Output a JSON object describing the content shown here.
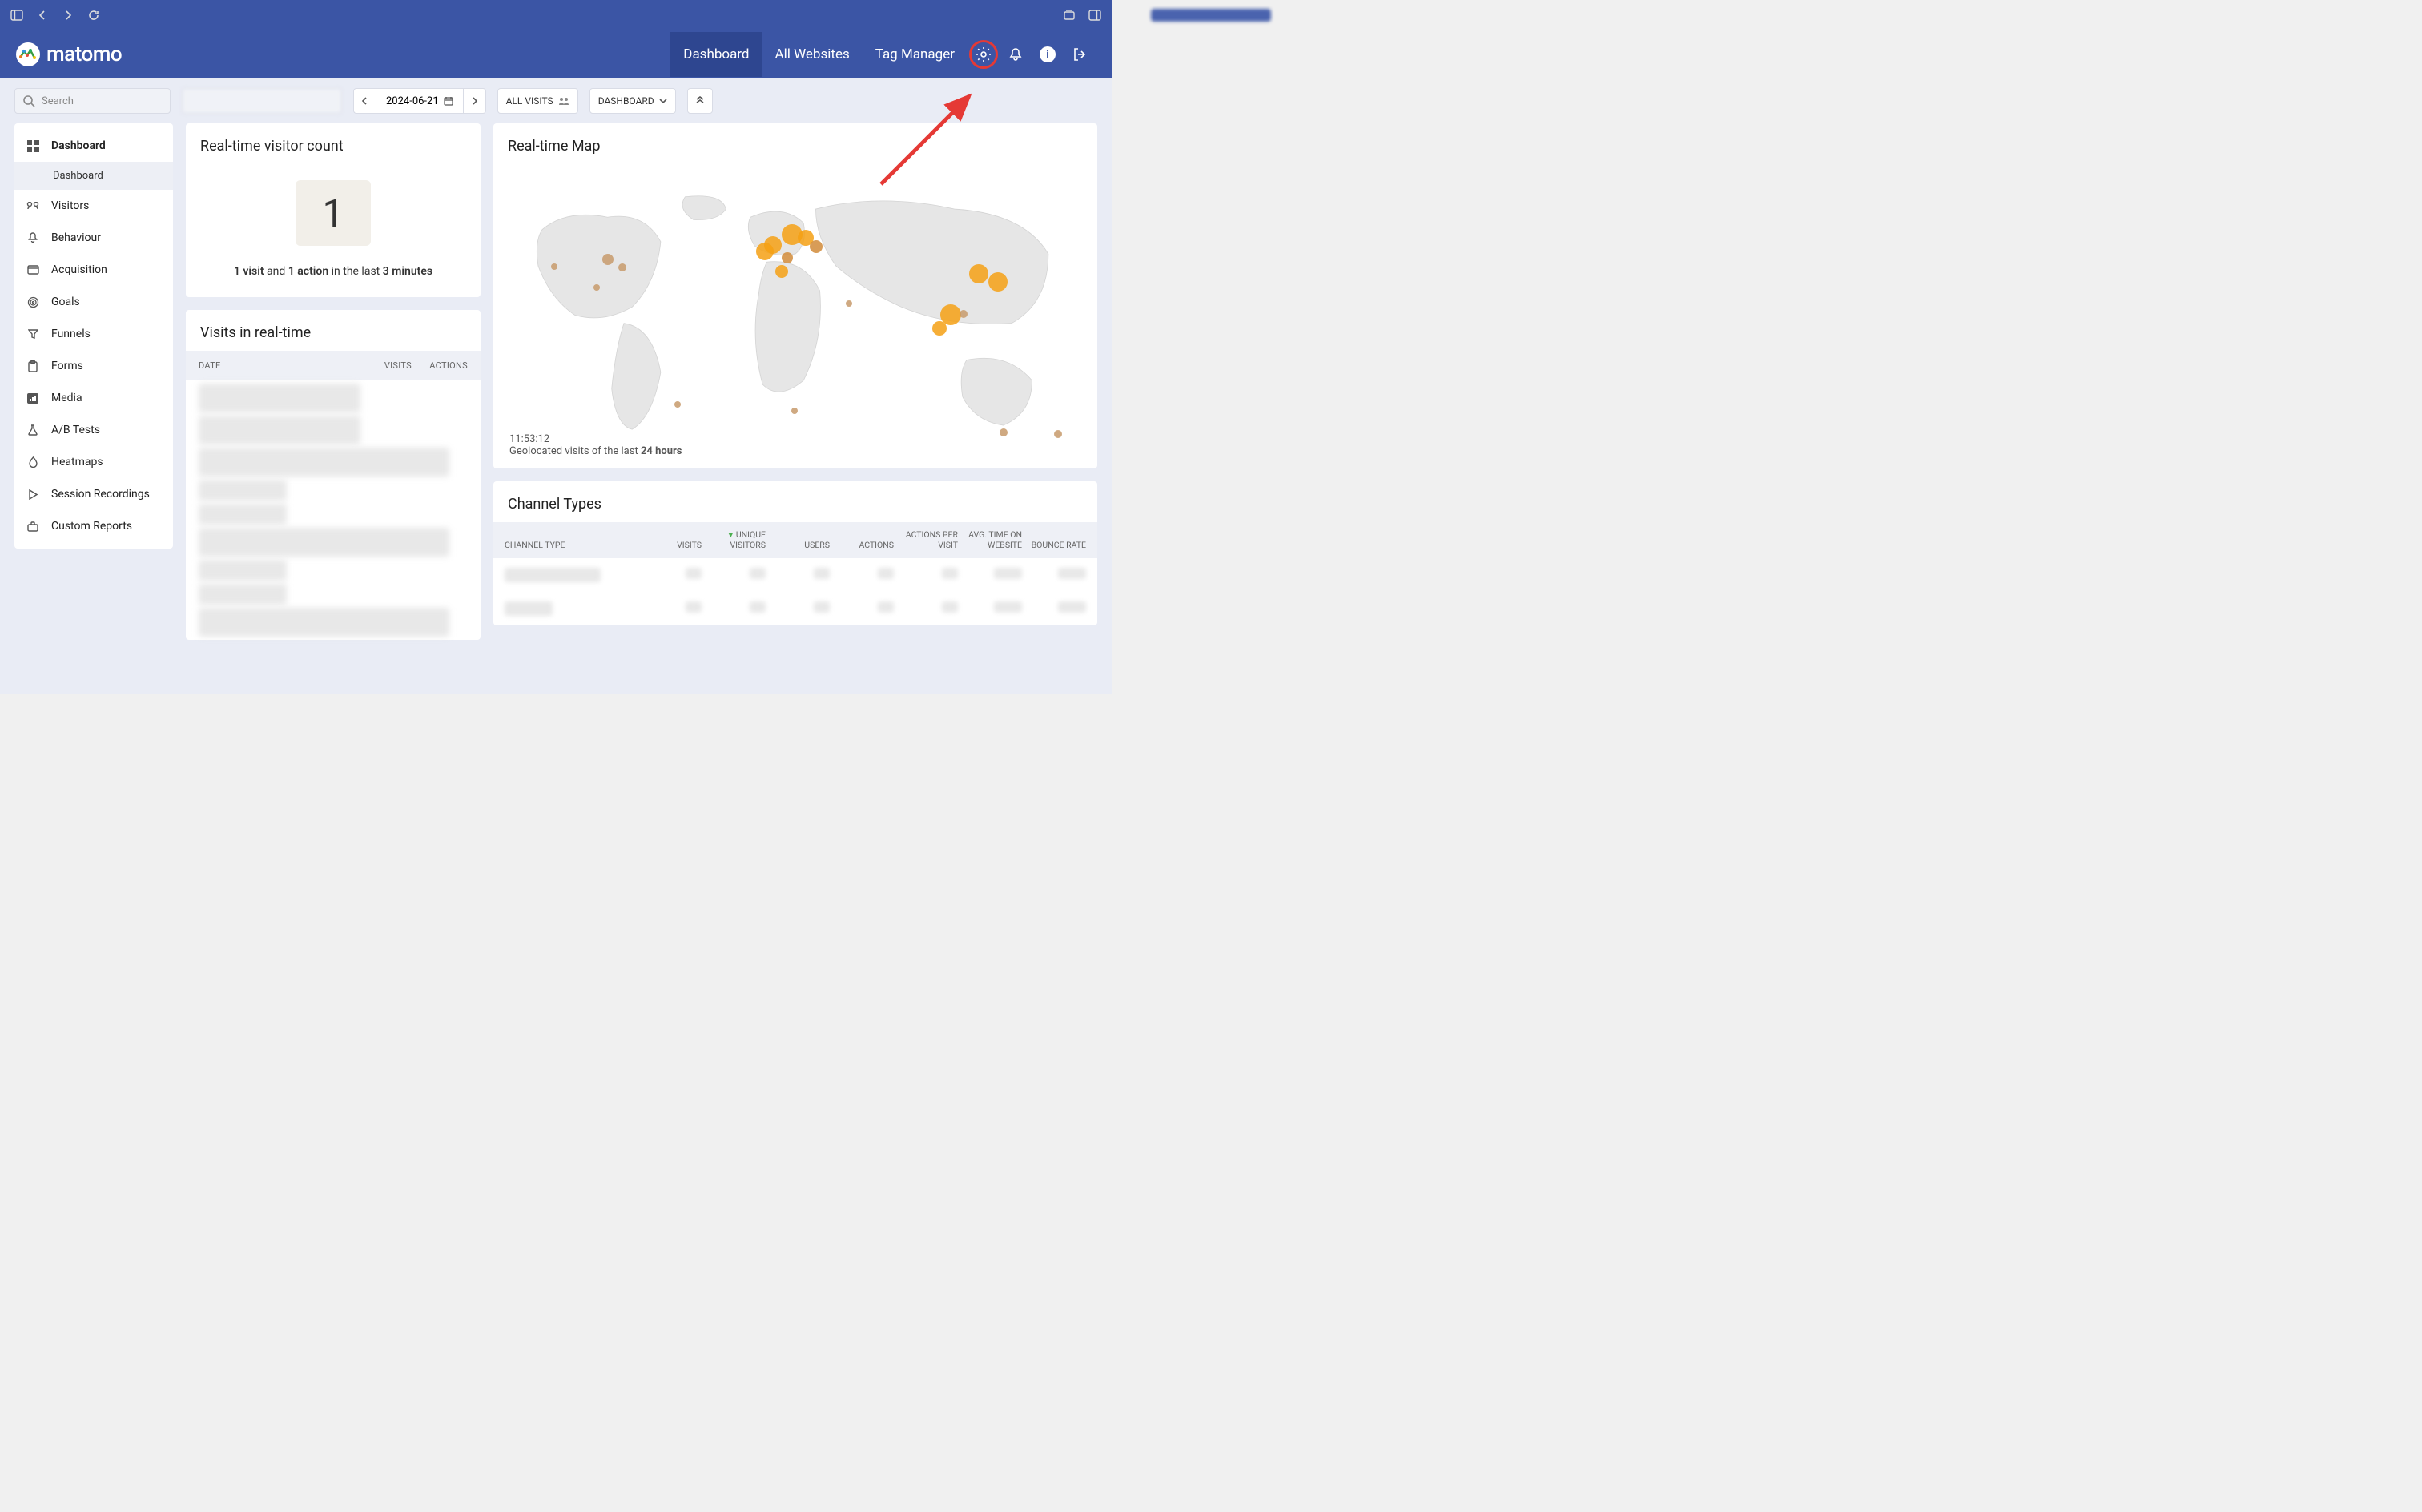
{
  "browser": {},
  "header": {
    "logo_text": "matomo",
    "nav": {
      "dashboard": "Dashboard",
      "all_websites": "All Websites",
      "tag_manager": "Tag Manager"
    }
  },
  "toolbar": {
    "search_placeholder": "Search",
    "date": "2024-06-21",
    "all_visits": "ALL VISITS",
    "dashboard_btn": "DASHBOARD"
  },
  "sidebar": {
    "items": [
      {
        "label": "Dashboard",
        "active": true
      },
      {
        "label": "Visitors"
      },
      {
        "label": "Behaviour"
      },
      {
        "label": "Acquisition"
      },
      {
        "label": "Goals"
      },
      {
        "label": "Funnels"
      },
      {
        "label": "Forms"
      },
      {
        "label": "Media"
      },
      {
        "label": "A/B Tests"
      },
      {
        "label": "Heatmaps"
      },
      {
        "label": "Session Recordings"
      },
      {
        "label": "Custom Reports"
      }
    ],
    "sub": {
      "dashboard": "Dashboard"
    }
  },
  "widgets": {
    "realtime_count": {
      "title": "Real-time visitor count",
      "value": "1",
      "visits": "1 visit",
      "and": " and ",
      "actions": "1 action",
      "in_last": " in the last ",
      "minutes": "3 minutes"
    },
    "realtime_visits": {
      "title": "Visits in real-time",
      "col_date": "DATE",
      "col_visits": "VISITS",
      "col_actions": "ACTIONS"
    },
    "realtime_map": {
      "title": "Real-time Map",
      "time": "11:53:12",
      "caption_prefix": "Geolocated visits of the last ",
      "caption_bold": "24 hours"
    },
    "channel_types": {
      "title": "Channel Types",
      "cols": {
        "channel": "CHANNEL TYPE",
        "visits": "VISITS",
        "unique": "UNIQUE VISITORS",
        "users": "USERS",
        "actions": "ACTIONS",
        "apv": "ACTIONS PER VISIT",
        "atow": "AVG. TIME ON WEBSITE",
        "bounce": "BOUNCE RATE"
      }
    }
  }
}
